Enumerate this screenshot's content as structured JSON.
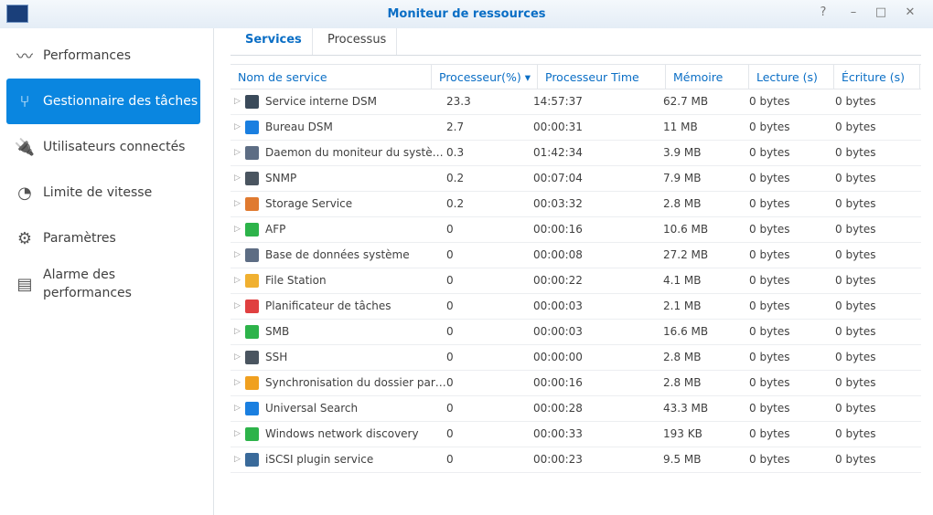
{
  "window": {
    "title": "Moniteur de ressources",
    "buttons": [
      "?",
      "–",
      "□",
      "✕"
    ]
  },
  "sidebar": {
    "items": [
      {
        "label": "Performances",
        "icon": "performance-chart-icon",
        "glyph": "〰"
      },
      {
        "label": "Gestionnaire des tâches",
        "icon": "task-manager-icon",
        "glyph": "⑂",
        "active": true
      },
      {
        "label": "Utilisateurs connectés",
        "icon": "plug-icon",
        "glyph": "🔌"
      },
      {
        "label": "Limite de vitesse",
        "icon": "speedometer-icon",
        "glyph": "◔"
      },
      {
        "label": "Paramètres",
        "icon": "gear-icon",
        "glyph": "⚙"
      },
      {
        "label": "Alarme des performances",
        "icon": "document-list-icon",
        "glyph": "▤"
      }
    ]
  },
  "tabs": [
    {
      "label": "Services",
      "active": true
    },
    {
      "label": "Processus"
    }
  ],
  "table": {
    "columns": [
      "Nom de service",
      "Processeur(%)",
      "Processeur Time",
      "Mémoire",
      "Lecture (s)",
      "Écriture (s)"
    ],
    "sort_indicator": "▾",
    "rows": [
      {
        "name": "Service interne DSM",
        "cpu": "23.3",
        "time": "14:57:37",
        "mem": "62.7 MB",
        "read": "0 bytes",
        "write": "0 bytes",
        "color": "#3a4a5a"
      },
      {
        "name": "Bureau DSM",
        "cpu": "2.7",
        "time": "00:00:31",
        "mem": "11 MB",
        "read": "0 bytes",
        "write": "0 bytes",
        "color": "#1a7fe0"
      },
      {
        "name": "Daemon du moniteur du système",
        "cpu": "0.3",
        "time": "01:42:34",
        "mem": "3.9 MB",
        "read": "0 bytes",
        "write": "0 bytes",
        "color": "#5d6d84"
      },
      {
        "name": "SNMP",
        "cpu": "0.2",
        "time": "00:07:04",
        "mem": "7.9 MB",
        "read": "0 bytes",
        "write": "0 bytes",
        "color": "#4a5560"
      },
      {
        "name": "Storage Service",
        "cpu": "0.2",
        "time": "00:03:32",
        "mem": "2.8 MB",
        "read": "0 bytes",
        "write": "0 bytes",
        "color": "#e07a30"
      },
      {
        "name": "AFP",
        "cpu": "0",
        "time": "00:00:16",
        "mem": "10.6 MB",
        "read": "0 bytes",
        "write": "0 bytes",
        "color": "#2db34a"
      },
      {
        "name": "Base de données système",
        "cpu": "0",
        "time": "00:00:08",
        "mem": "27.2 MB",
        "read": "0 bytes",
        "write": "0 bytes",
        "color": "#5d6d84"
      },
      {
        "name": "File Station",
        "cpu": "0",
        "time": "00:00:22",
        "mem": "4.1 MB",
        "read": "0 bytes",
        "write": "0 bytes",
        "color": "#f0b030"
      },
      {
        "name": "Planificateur de tâches",
        "cpu": "0",
        "time": "00:00:03",
        "mem": "2.1 MB",
        "read": "0 bytes",
        "write": "0 bytes",
        "color": "#e04040"
      },
      {
        "name": "SMB",
        "cpu": "0",
        "time": "00:00:03",
        "mem": "16.6 MB",
        "read": "0 bytes",
        "write": "0 bytes",
        "color": "#2db34a"
      },
      {
        "name": "SSH",
        "cpu": "0",
        "time": "00:00:00",
        "mem": "2.8 MB",
        "read": "0 bytes",
        "write": "0 bytes",
        "color": "#4a5560"
      },
      {
        "name": "Synchronisation du dossier partagé",
        "cpu": "0",
        "time": "00:00:16",
        "mem": "2.8 MB",
        "read": "0 bytes",
        "write": "0 bytes",
        "color": "#f0a020"
      },
      {
        "name": "Universal Search",
        "cpu": "0",
        "time": "00:00:28",
        "mem": "43.3 MB",
        "read": "0 bytes",
        "write": "0 bytes",
        "color": "#1a7fe0"
      },
      {
        "name": "Windows network discovery",
        "cpu": "0",
        "time": "00:00:33",
        "mem": "193 KB",
        "read": "0 bytes",
        "write": "0 bytes",
        "color": "#2db34a"
      },
      {
        "name": "iSCSI plugin service",
        "cpu": "0",
        "time": "00:00:23",
        "mem": "9.5 MB",
        "read": "0 bytes",
        "write": "0 bytes",
        "color": "#3a6a9a"
      }
    ]
  }
}
